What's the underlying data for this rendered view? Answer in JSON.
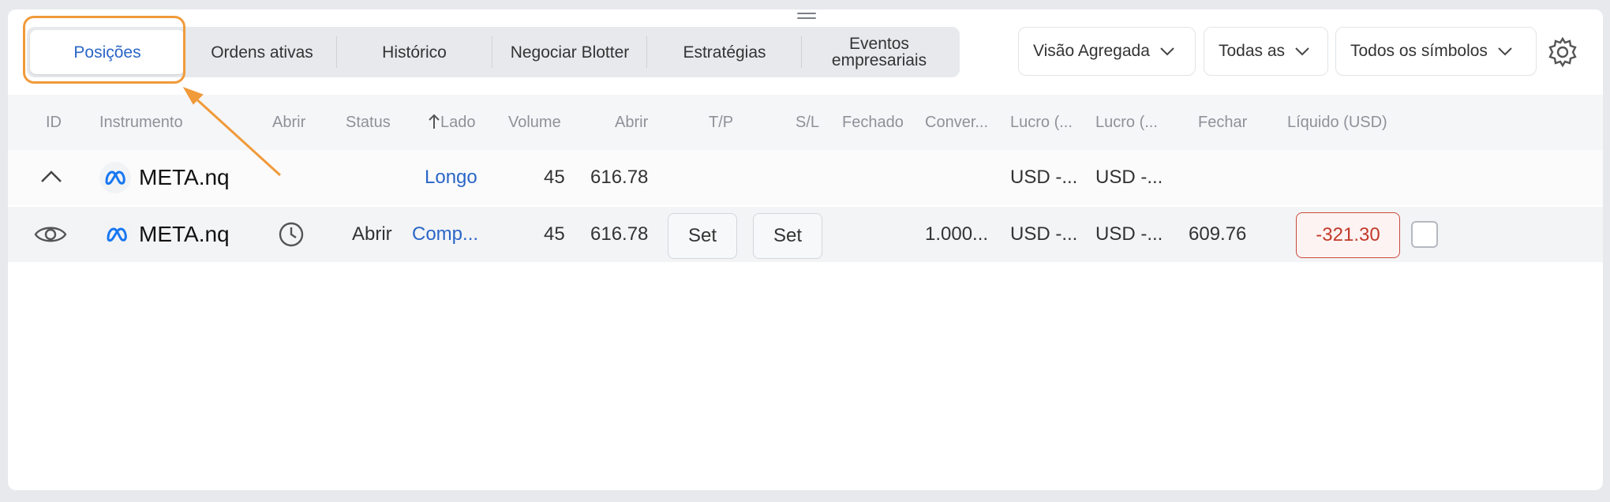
{
  "tabs": [
    {
      "label": "Posições",
      "active": true
    },
    {
      "label": "Ordens ativas"
    },
    {
      "label": "Histórico"
    },
    {
      "label": "Negociar Blotter"
    },
    {
      "label": "Estratégias"
    },
    {
      "label": "Eventos empresariais"
    }
  ],
  "filters": {
    "view": "Visão Agregada",
    "all": "Todas as",
    "symbols": "Todos os símbolos"
  },
  "columns": {
    "id": "ID",
    "instrument": "Instrumento",
    "open_time": "Abrir",
    "status": "Status",
    "side": "Lado",
    "volume": "Volume",
    "open_price": "Abrir",
    "tp": "T/P",
    "sl": "S/L",
    "closed": "Fechado",
    "conversion": "Conver...",
    "profit1": "Lucro (...",
    "profit2": "Lucro (...",
    "close": "Fechar",
    "net": "Líquido (USD)"
  },
  "rows": [
    {
      "symbol": "META.nq",
      "side": "Longo",
      "volume": "45",
      "open_price": "616.78",
      "profit1": "USD -...",
      "profit2": "USD -..."
    },
    {
      "symbol": "META.nq",
      "status": "Abrir",
      "side": "Comp...",
      "volume": "45",
      "open_price": "616.78",
      "tp_button": "Set",
      "sl_button": "Set",
      "conversion": "1.000...",
      "profit1": "USD -...",
      "profit2": "USD -...",
      "close": "609.76",
      "net": "-321.30"
    }
  ],
  "colors": {
    "accent": "#2a66c7",
    "highlight": "#f09a3a",
    "loss": "#c23a2a"
  }
}
